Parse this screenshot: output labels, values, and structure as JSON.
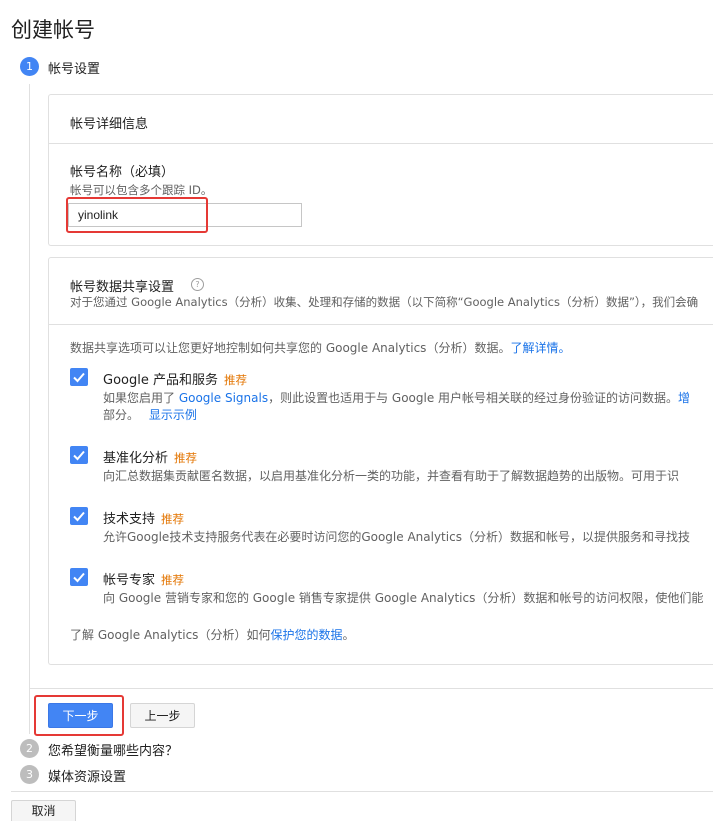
{
  "page": {
    "title": "创建帐号"
  },
  "steps": [
    {
      "number": "1",
      "label": "帐号设置"
    },
    {
      "number": "2",
      "label": "您希望衡量哪些内容？"
    },
    {
      "number": "3",
      "label": "媒体资源设置"
    }
  ],
  "account_details": {
    "header": "帐号详细信息",
    "name_label": "帐号名称（必填）",
    "name_hint": "帐号可以包含多个跟踪 ID。",
    "name_value": "yinolink"
  },
  "data_sharing": {
    "header": "帐号数据共享设置",
    "help_icon": "help-circle-icon",
    "subtitle": "对于您通过 Google Analytics（分析）收集、处理和存储的数据（以下简称“Google Analytics（分析）数据”），我们会确",
    "intro_text": "数据共享选项可以让您更好地控制如何共享您的 Google Analytics（分析）数据。",
    "intro_link": "了解详情。",
    "options": [
      {
        "title": "Google 产品和服务",
        "badge": "推荐",
        "checked": true,
        "desc_prefix": "如果您启用了 ",
        "desc_link": "Google Signals",
        "desc_suffix": "，则此设置也适用于与 Google 用户帐号相关联的经过身份验证的访问数据。",
        "desc_trailing_link": "增",
        "desc_line2": "部分。",
        "desc_line2_link": "显示示例"
      },
      {
        "title": "基准化分析",
        "badge": "推荐",
        "checked": true,
        "desc": "向汇总数据集贡献匿名数据，以启用基准化分析一类的功能，并查看有助于了解数据趋势的出版物。可用于识"
      },
      {
        "title": "技术支持",
        "badge": "推荐",
        "checked": true,
        "desc": "允许Google技术支持服务代表在必要时访问您的Google Analytics（分析）数据和帐号，以提供服务和寻找技"
      },
      {
        "title": "帐号专家",
        "badge": "推荐",
        "checked": true,
        "desc": "向 Google 营销专家和您的 Google 销售专家提供 Google Analytics（分析）数据和帐号的访问权限，使他们能"
      }
    ],
    "footer_text": "了解 Google Analytics（分析）如何",
    "footer_link": "保护您的数据",
    "footer_end": "。"
  },
  "buttons": {
    "next": "下一步",
    "back": "上一步",
    "cancel": "取消"
  },
  "colors": {
    "accent": "#4285f4",
    "badge": "#e37400",
    "highlight": "#e53935",
    "link": "#1a73e8"
  }
}
